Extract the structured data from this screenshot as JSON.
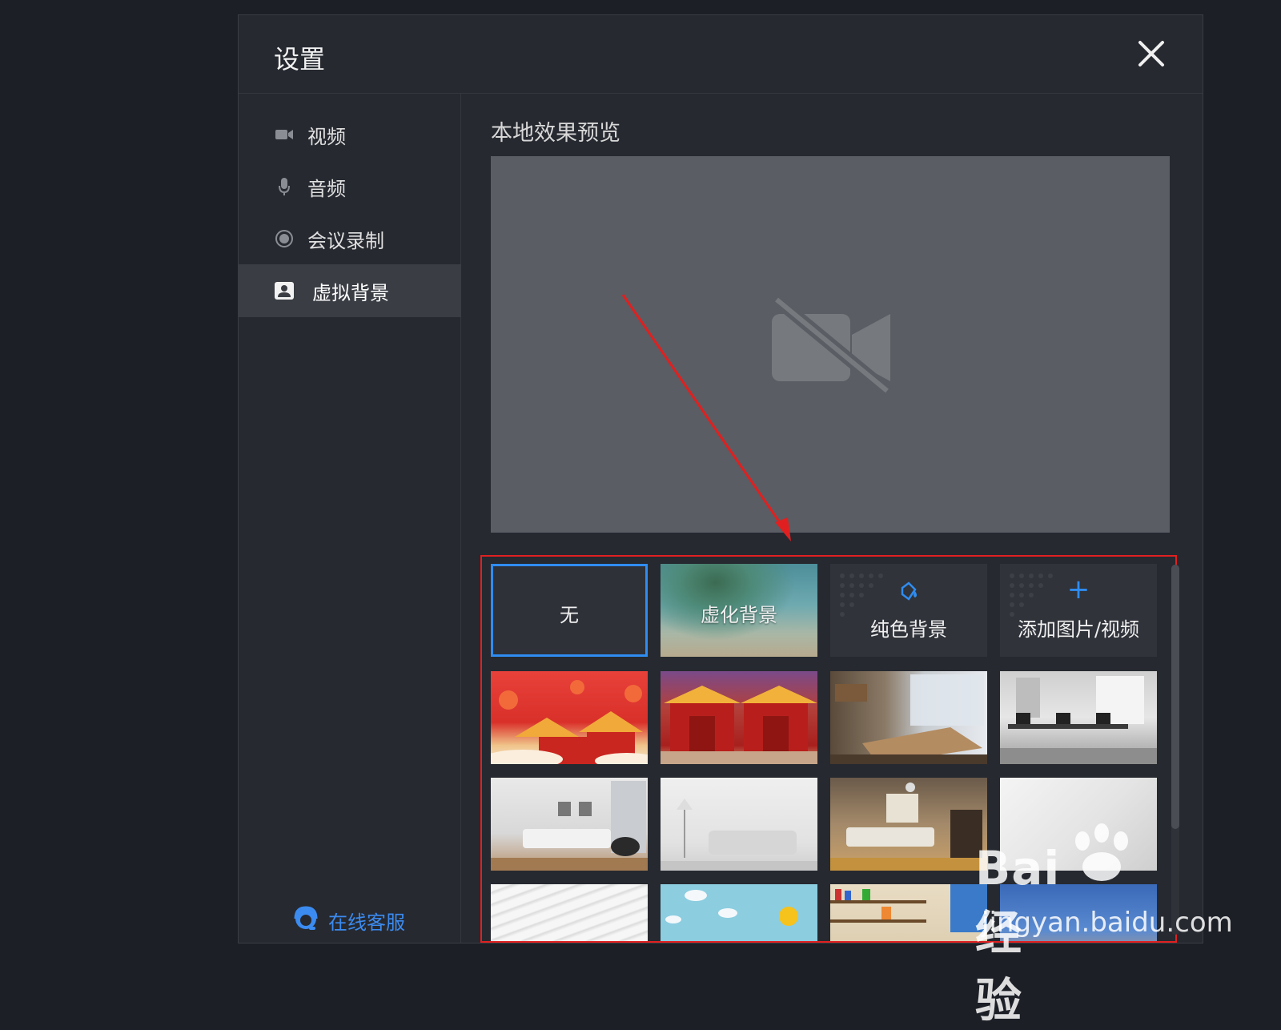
{
  "dialog": {
    "title": "设置",
    "close_icon": "close-icon"
  },
  "sidebar": {
    "items": [
      {
        "label": "视频",
        "icon": "video-camera-icon"
      },
      {
        "label": "音频",
        "icon": "microphone-icon"
      },
      {
        "label": "会议录制",
        "icon": "record-icon"
      },
      {
        "label": "虚拟背景",
        "icon": "portrait-icon",
        "active": true
      }
    ],
    "support_label": "在线客服",
    "support_icon": "headset-icon"
  },
  "content": {
    "preview_title": "本地效果预览",
    "preview_icon": "camera-off-icon",
    "backgrounds": {
      "none_label": "无",
      "blur_label": "虚化背景",
      "solid_label": "纯色背景",
      "add_label": "添加图片/视频",
      "add_symbol": "+"
    }
  },
  "watermark": {
    "brand": "Bai经验",
    "url": "jingyan.baidu.com"
  },
  "colors": {
    "accent": "#2f8cf0",
    "support_blue": "#3b8bf0",
    "highlight_red": "#e02020",
    "background": "#262930"
  }
}
